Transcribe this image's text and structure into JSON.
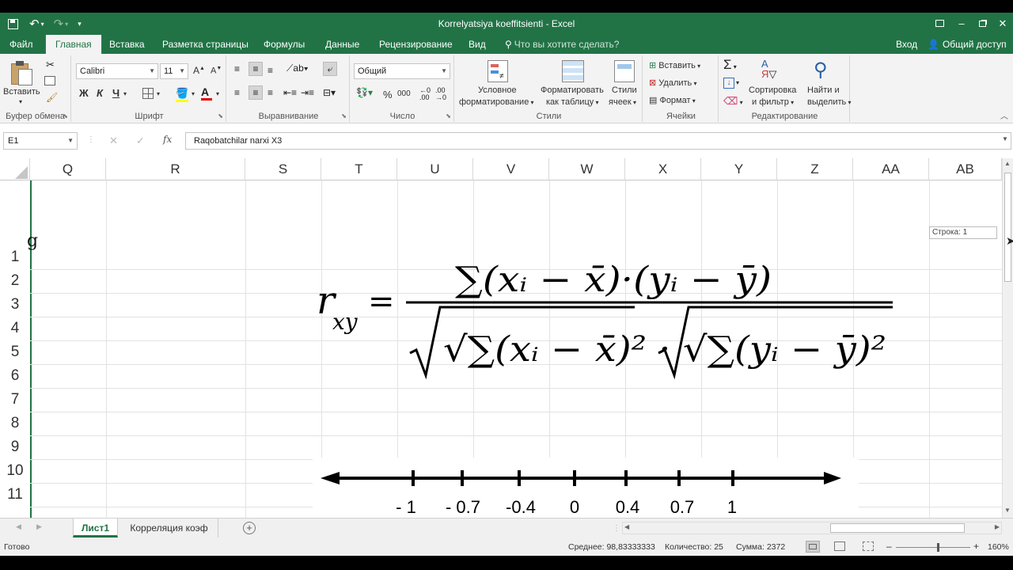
{
  "window": {
    "title": "Korrelyatsiya koeffitsienti - Excel"
  },
  "tabs": {
    "file": "Файл",
    "home": "Главная",
    "insert": "Вставка",
    "layout": "Разметка страницы",
    "formulas": "Формулы",
    "data": "Данные",
    "review": "Рецензирование",
    "view": "Вид",
    "tell_me": "Что вы хотите сделать?",
    "sign_in": "Вход",
    "share": "Общий доступ"
  },
  "ribbon": {
    "clipboard": {
      "paste": "Вставить",
      "label": "Буфер обмена"
    },
    "font": {
      "name": "Calibri",
      "size": "11",
      "bold": "Ж",
      "italic": "К",
      "underline": "Ч",
      "label": "Шрифт"
    },
    "alignment": {
      "label": "Выравнивание"
    },
    "number": {
      "format": "Общий",
      "percent": "%",
      "thousands": "000",
      "label": "Число"
    },
    "styles": {
      "conditional_1": "Условное",
      "conditional_2": "форматирование",
      "format_table_1": "Форматировать",
      "format_table_2": "как таблицу",
      "cell_styles_1": "Стили",
      "cell_styles_2": "ячеек",
      "label": "Стили"
    },
    "cells": {
      "insert": "Вставить",
      "delete": "Удалить",
      "format": "Формат",
      "label": "Ячейки"
    },
    "editing": {
      "sort_1": "Сортировка",
      "sort_2": "и фильтр",
      "find_1": "Найти и",
      "find_2": "выделить",
      "label": "Редактирование"
    }
  },
  "formula_bar": {
    "name_box": "E1",
    "fx": "fx",
    "content": "Raqobatchilar narxi X3"
  },
  "columns": [
    "Q",
    "R",
    "S",
    "T",
    "U",
    "V",
    "W",
    "X",
    "Y",
    "Z",
    "AA",
    "AB"
  ],
  "rows": [
    "1",
    "2",
    "3",
    "4",
    "5",
    "6",
    "7",
    "8",
    "9",
    "10",
    "11"
  ],
  "scroll_tooltip": "Строка: 1",
  "formula_image": {
    "lhs_var": "r",
    "lhs_sub": "xy",
    "equals": "=",
    "numerator": "∑(xᵢ − x̄)·(yᵢ − ȳ)",
    "denominator": "√∑(xᵢ − x̄)² · √∑(yᵢ − ȳ)²"
  },
  "axis_labels": [
    "- 1",
    "- 0.7",
    "-0.4",
    "0",
    "0.4",
    "0.7",
    "1"
  ],
  "sheet_tabs": [
    "Лист1",
    "Корреляция коэф"
  ],
  "status": {
    "ready": "Готово",
    "average": "Среднее: 98,83333333",
    "count": "Количество: 25",
    "sum": "Сумма: 2372",
    "zoom": "160%"
  }
}
